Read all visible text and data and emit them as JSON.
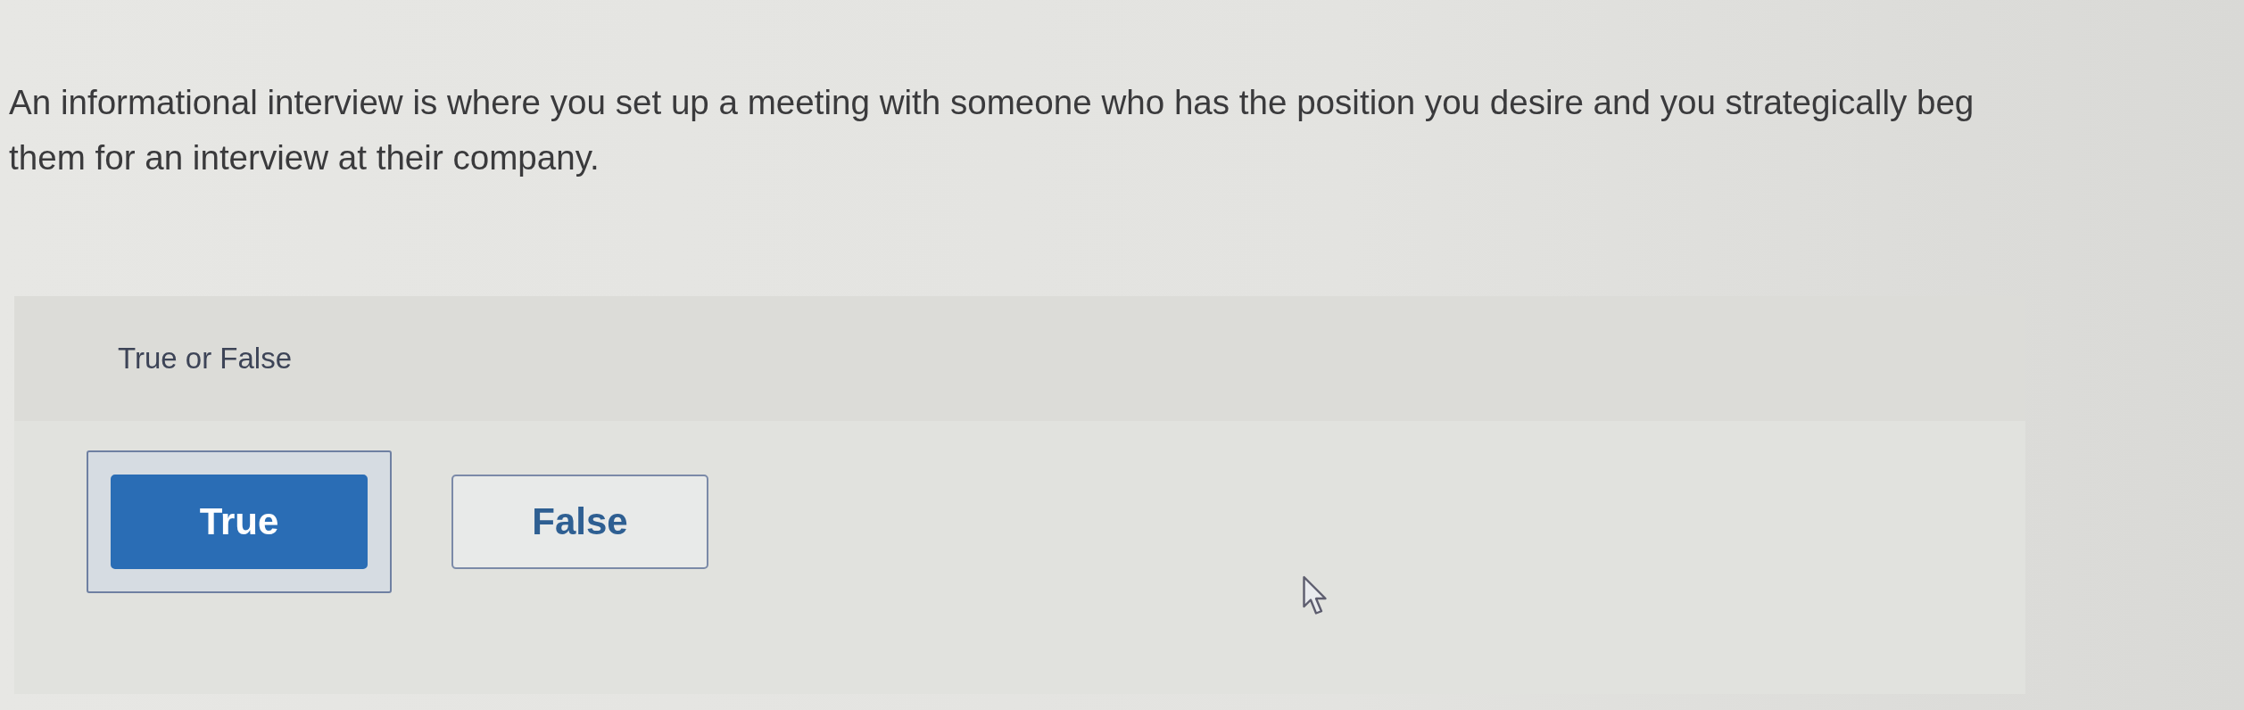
{
  "question": {
    "text": "An informational interview is where you set up a meeting with someone who has the position you desire and you strategically beg them for an interview at their company."
  },
  "answer_panel": {
    "title": "True or False",
    "options": [
      {
        "label": "True",
        "selected": true
      },
      {
        "label": "False",
        "selected": false
      }
    ]
  }
}
